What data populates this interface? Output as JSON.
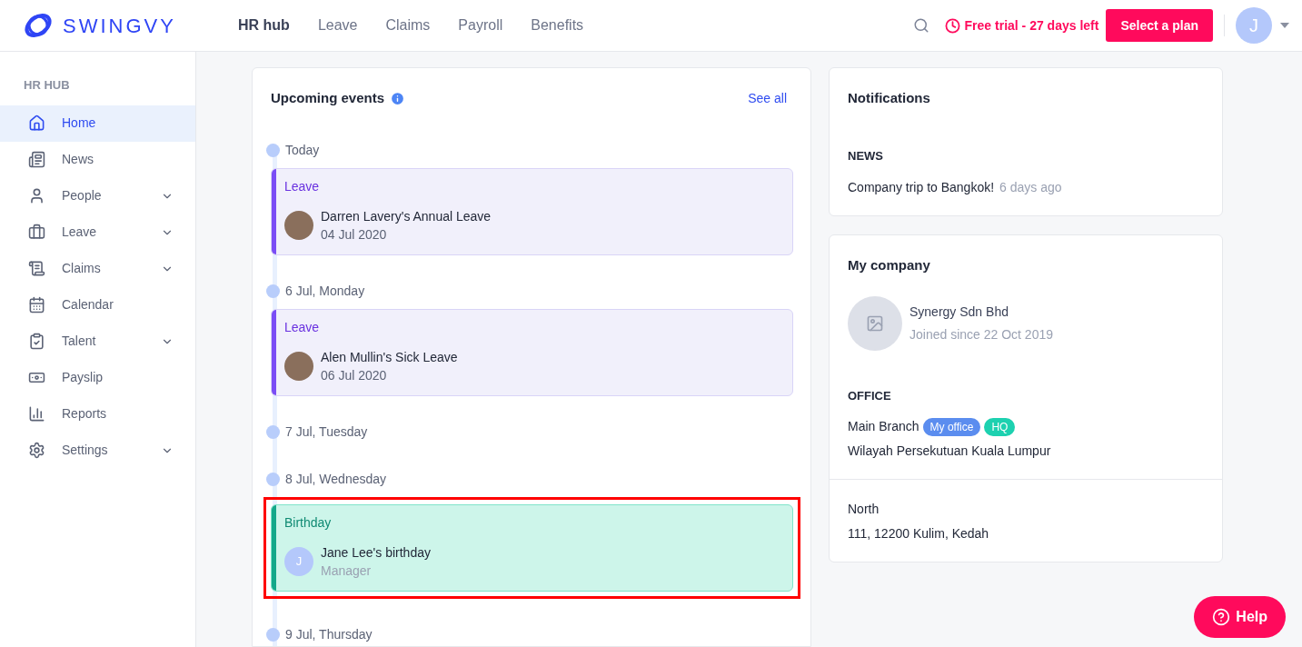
{
  "header": {
    "logo": "SWINGVY",
    "nav": [
      {
        "label": "HR hub",
        "selected": true
      },
      {
        "label": "Leave",
        "selected": false
      },
      {
        "label": "Claims",
        "selected": false
      },
      {
        "label": "Payroll",
        "selected": false
      },
      {
        "label": "Benefits",
        "selected": false
      }
    ],
    "trial": "Free trial - 27 days left",
    "cta": "Select a plan",
    "avatar_initial": "J"
  },
  "sidebar": {
    "heading": "HR HUB",
    "items": [
      {
        "label": "Home",
        "selected": true,
        "expandable": false
      },
      {
        "label": "News",
        "selected": false,
        "expandable": false
      },
      {
        "label": "People",
        "selected": false,
        "expandable": true
      },
      {
        "label": "Leave",
        "selected": false,
        "expandable": true
      },
      {
        "label": "Claims",
        "selected": false,
        "expandable": true
      },
      {
        "label": "Calendar",
        "selected": false,
        "expandable": false
      },
      {
        "label": "Talent",
        "selected": false,
        "expandable": true
      },
      {
        "label": "Payslip",
        "selected": false,
        "expandable": false
      },
      {
        "label": "Reports",
        "selected": false,
        "expandable": false
      },
      {
        "label": "Settings",
        "selected": false,
        "expandable": true
      }
    ]
  },
  "upcoming_events": {
    "title": "Upcoming events",
    "see_all": "See all",
    "days": [
      {
        "date": "Today",
        "events": [
          {
            "kind": "leave",
            "type": "Leave",
            "title": "Darren Lavery's Annual Leave",
            "subtitle": "04 Jul 2020",
            "has_photo": true,
            "highlighted": false
          }
        ]
      },
      {
        "date": "6 Jul, Monday",
        "events": [
          {
            "kind": "leave",
            "type": "Leave",
            "title": "Alen Mullin's Sick Leave",
            "subtitle": "06 Jul 2020",
            "has_photo": true,
            "highlighted": false
          }
        ]
      },
      {
        "date": "7 Jul, Tuesday"
      },
      {
        "date": "8 Jul, Wednesday",
        "events": [
          {
            "kind": "birthday",
            "type": "Birthday",
            "title": "Jane Lee's birthday",
            "subtitle": "Manager",
            "has_photo": false,
            "initial": "J",
            "highlighted": true
          }
        ]
      },
      {
        "date": "9 Jul, Thursday"
      }
    ]
  },
  "notifications": {
    "title": "Notifications",
    "section": "NEWS",
    "items": [
      {
        "text": "Company trip to Bangkok!",
        "time": "6 days ago"
      }
    ]
  },
  "my_company": {
    "title": "My company",
    "name": "Synergy Sdn Bhd",
    "joined": "Joined since 22 Oct 2019",
    "office_heading": "OFFICE",
    "offices": [
      {
        "name": "Main Branch",
        "tags": [
          {
            "label": "My office",
            "color": "#5b8def"
          },
          {
            "label": "HQ",
            "color": "#1dd1b0"
          }
        ],
        "address": "Wilayah Persekutuan Kuala Lumpur"
      },
      {
        "name": "North",
        "address": "111, 12200 Kulim, Kedah"
      }
    ]
  },
  "help": "Help"
}
